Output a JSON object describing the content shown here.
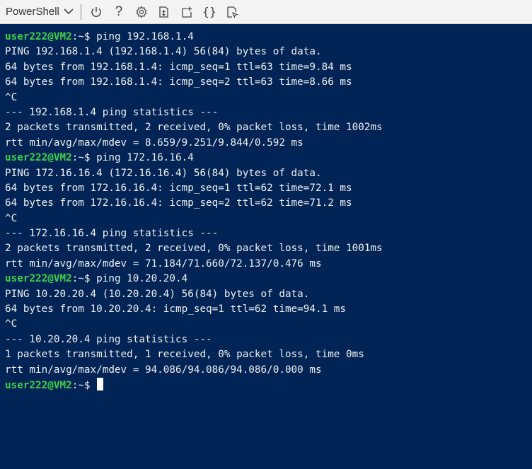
{
  "toolbar": {
    "shell_label": "PowerShell",
    "chevron_icon": "chevron-down-icon",
    "buttons": [
      {
        "name": "power-button",
        "icon": "power-icon",
        "glyph": "⏻"
      },
      {
        "name": "help-button",
        "icon": "question-icon",
        "glyph": "?"
      },
      {
        "name": "settings-button",
        "icon": "gear-icon",
        "glyph": "⚙"
      },
      {
        "name": "upload-download-button",
        "icon": "upload-download-icon",
        "glyph": ""
      },
      {
        "name": "new-session-button",
        "icon": "new-session-icon",
        "glyph": ""
      },
      {
        "name": "editor-button",
        "icon": "braces-icon",
        "glyph": "{}"
      },
      {
        "name": "web-preview-button",
        "icon": "web-preview-icon",
        "glyph": ""
      }
    ]
  },
  "terminal": {
    "background": "#012456",
    "prompt_color": "#3fd14a",
    "lines": [
      {
        "type": "prompt",
        "user": "user222@VM2",
        "tail": ":~$ ",
        "cmd": "ping 192.168.1.4"
      },
      {
        "type": "out",
        "text": "PING 192.168.1.4 (192.168.1.4) 56(84) bytes of data."
      },
      {
        "type": "out",
        "text": "64 bytes from 192.168.1.4: icmp_seq=1 ttl=63 time=9.84 ms"
      },
      {
        "type": "out",
        "text": "64 bytes from 192.168.1.4: icmp_seq=2 ttl=63 time=8.66 ms"
      },
      {
        "type": "out",
        "text": "^C"
      },
      {
        "type": "out",
        "text": "--- 192.168.1.4 ping statistics ---"
      },
      {
        "type": "out",
        "text": "2 packets transmitted, 2 received, 0% packet loss, time 1002ms"
      },
      {
        "type": "out",
        "text": "rtt min/avg/max/mdev = 8.659/9.251/9.844/0.592 ms"
      },
      {
        "type": "prompt",
        "user": "user222@VM2",
        "tail": ":~$ ",
        "cmd": "ping 172.16.16.4"
      },
      {
        "type": "out",
        "text": "PING 172.16.16.4 (172.16.16.4) 56(84) bytes of data."
      },
      {
        "type": "out",
        "text": "64 bytes from 172.16.16.4: icmp_seq=1 ttl=62 time=72.1 ms"
      },
      {
        "type": "out",
        "text": "64 bytes from 172.16.16.4: icmp_seq=2 ttl=62 time=71.2 ms"
      },
      {
        "type": "out",
        "text": "^C"
      },
      {
        "type": "out",
        "text": "--- 172.16.16.4 ping statistics ---"
      },
      {
        "type": "out",
        "text": "2 packets transmitted, 2 received, 0% packet loss, time 1001ms"
      },
      {
        "type": "out",
        "text": "rtt min/avg/max/mdev = 71.184/71.660/72.137/0.476 ms"
      },
      {
        "type": "prompt",
        "user": "user222@VM2",
        "tail": ":~$ ",
        "cmd": "ping 10.20.20.4"
      },
      {
        "type": "out",
        "text": "PING 10.20.20.4 (10.20.20.4) 56(84) bytes of data."
      },
      {
        "type": "out",
        "text": "64 bytes from 10.20.20.4: icmp_seq=1 ttl=62 time=94.1 ms"
      },
      {
        "type": "out",
        "text": "^C"
      },
      {
        "type": "out",
        "text": "--- 10.20.20.4 ping statistics ---"
      },
      {
        "type": "out",
        "text": "1 packets transmitted, 1 received, 0% packet loss, time 0ms"
      },
      {
        "type": "out",
        "text": "rtt min/avg/max/mdev = 94.086/94.086/94.086/0.000 ms"
      },
      {
        "type": "prompt",
        "user": "user222@VM2",
        "tail": ":~$ ",
        "cmd": "",
        "cursor": true
      }
    ]
  }
}
